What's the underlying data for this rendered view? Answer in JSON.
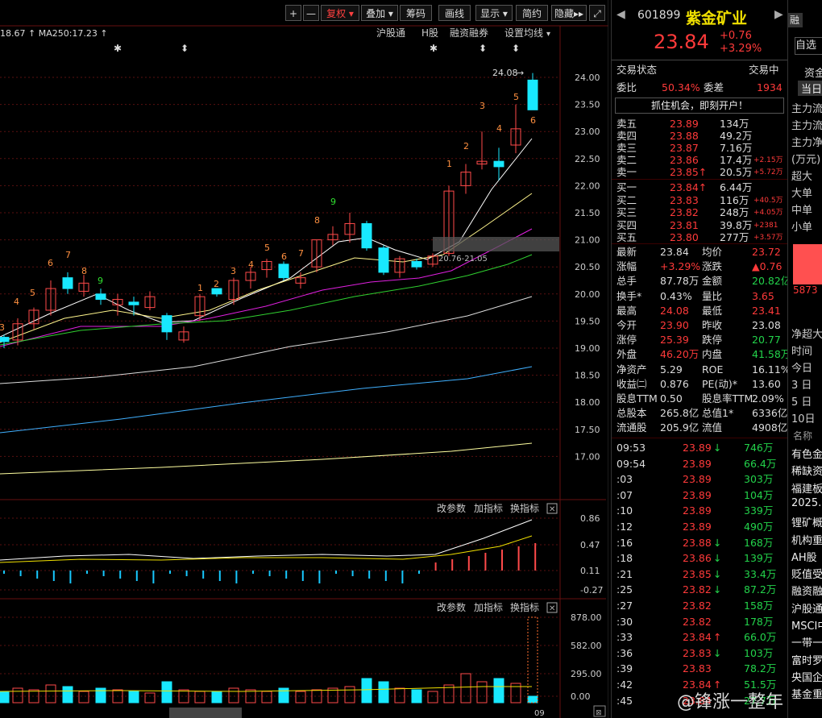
{
  "toolbar": {
    "buttons": [
      "+",
      "—",
      "复权",
      "叠加",
      "筹码",
      "画线",
      "显示",
      "简约",
      "隐藏"
    ],
    "expand_icon": "expand-icon"
  },
  "chart": {
    "ma_info": "18.67 ↑  MA250:17.23 ↑",
    "links": [
      "沪股通",
      "H股",
      "融资融券",
      "设置均线"
    ],
    "price_axis": [
      "24.00",
      "23.50",
      "23.00",
      "22.50",
      "22.00",
      "21.50",
      "21.00",
      "20.50",
      "20.00",
      "19.50",
      "19.00",
      "18.50",
      "18.00",
      "17.50",
      "17.00"
    ],
    "high_label": "24.08",
    "zone_label": "20.76-21.05",
    "td_labels": [
      "3",
      "4",
      "5",
      "6",
      "7",
      "8",
      "9",
      "1",
      "2",
      "3",
      "4",
      "5",
      "6",
      "7",
      "8",
      "9",
      "1",
      "2",
      "3",
      "4",
      "5",
      "6"
    ],
    "macd_axis": [
      "0.86",
      "0.47",
      "0.11",
      "-0.27"
    ],
    "vol_axis": [
      "878.00",
      "582.00",
      "295.00",
      "0.00"
    ],
    "sub_links": [
      "改参数",
      "加指标",
      "换指标"
    ],
    "date_label": "09"
  },
  "quote": {
    "code": "601899",
    "name": "紫金矿业",
    "price": "23.84",
    "change": "+0.76",
    "change_pct": "+3.29%",
    "rong": "融",
    "zi": "自选",
    "status_label": "交易状态",
    "status_value": "交易中",
    "weibi_label": "委比",
    "weibi_value": "50.34%",
    "weicha_label": "委差",
    "weicha_value": "1934",
    "banner": "抓住机会，即刻开户！",
    "asks": [
      {
        "label": "卖五",
        "price": "23.89",
        "vol": "134万",
        "chg": ""
      },
      {
        "label": "卖四",
        "price": "23.88",
        "vol": "49.2万",
        "chg": ""
      },
      {
        "label": "卖三",
        "price": "23.87",
        "vol": "7.16万",
        "chg": ""
      },
      {
        "label": "卖二",
        "price": "23.86",
        "vol": "17.4万",
        "chg": "+2.15万"
      },
      {
        "label": "卖一",
        "price": "23.85↑",
        "vol": "20.5万",
        "chg": "+5.72万"
      }
    ],
    "bids": [
      {
        "label": "买一",
        "price": "23.84↑",
        "vol": "6.44万",
        "chg": ""
      },
      {
        "label": "买二",
        "price": "23.83",
        "vol": "116万",
        "chg": "+40.5万"
      },
      {
        "label": "买三",
        "price": "23.82",
        "vol": "248万",
        "chg": "+4.05万"
      },
      {
        "label": "买四",
        "price": "23.81",
        "vol": "39.8万",
        "chg": "+2381"
      },
      {
        "label": "买五",
        "price": "23.80",
        "vol": "277万",
        "chg": "+3.57万"
      }
    ],
    "stats": [
      [
        "最新",
        "23.84",
        "均价",
        "23.72"
      ],
      [
        "涨幅",
        "+3.29%",
        "涨跌",
        "▲0.76"
      ],
      [
        "总手",
        "87.78万",
        "金额",
        "20.82亿"
      ],
      [
        "换手*",
        "0.43%",
        "量比",
        "3.65"
      ],
      [
        "最高",
        "24.08",
        "最低",
        "23.41"
      ],
      [
        "今开",
        "23.90",
        "昨收",
        "23.08"
      ],
      [
        "涨停",
        "25.39",
        "跌停",
        "20.77"
      ],
      [
        "外盘",
        "46.20万",
        "内盘",
        "41.58万"
      ],
      [
        "净资产",
        "5.29",
        "ROE",
        "16.11%"
      ],
      [
        "收益㈡",
        "0.876",
        "PE(动)*",
        "13.60"
      ],
      [
        "股息TTM",
        "0.50",
        "股息率TTM",
        "2.09%"
      ],
      [
        "总股本",
        "265.8亿",
        "总值1*",
        "6336亿"
      ],
      [
        "流通股",
        "205.9亿",
        "流值",
        "4908亿"
      ]
    ],
    "ticks": [
      {
        "t": "09:53",
        "p": "23.89",
        "arrow": "↓",
        "v": "746万"
      },
      {
        "t": "09:54",
        "p": "23.89",
        "arrow": "",
        "v": "66.4万"
      },
      {
        "t": ":03",
        "p": "23.89",
        "arrow": "",
        "v": "303万"
      },
      {
        "t": ":07",
        "p": "23.89",
        "arrow": "",
        "v": "104万"
      },
      {
        "t": ":10",
        "p": "23.89",
        "arrow": "",
        "v": "339万"
      },
      {
        "t": ":12",
        "p": "23.89",
        "arrow": "",
        "v": "490万"
      },
      {
        "t": ":16",
        "p": "23.88",
        "arrow": "↓",
        "v": "168万"
      },
      {
        "t": ":18",
        "p": "23.86",
        "arrow": "↓",
        "v": "139万"
      },
      {
        "t": ":21",
        "p": "23.85",
        "arrow": "↓",
        "v": "33.4万"
      },
      {
        "t": ":25",
        "p": "23.82",
        "arrow": "↓",
        "v": "87.2万"
      },
      {
        "t": ":27",
        "p": "23.82",
        "arrow": "",
        "v": "158万"
      },
      {
        "t": ":30",
        "p": "23.82",
        "arrow": "",
        "v": "178万"
      },
      {
        "t": ":33",
        "p": "23.84",
        "arrow": "↑",
        "v": "66.0万"
      },
      {
        "t": ":36",
        "p": "23.83",
        "arrow": "↓",
        "v": "103万"
      },
      {
        "t": ":39",
        "p": "23.83",
        "arrow": "",
        "v": "78.2万"
      },
      {
        "t": ":42",
        "p": "23.84",
        "arrow": "↑",
        "v": "51.5万"
      },
      {
        "t": ":45",
        "p": "23.84",
        "arrow": "",
        "v": "27.7万"
      }
    ]
  },
  "edge": {
    "tab_top": "资金",
    "tab_sub": "当日",
    "lines": [
      "主力流",
      "主力流",
      "主力净",
      "(万元)",
      "超大",
      "大单",
      "中单",
      "小单"
    ],
    "bar_value": "5873",
    "mid_lines": [
      "净超大",
      "时间",
      "今日",
      "3 日",
      "5 日",
      "10日"
    ],
    "name_label": "名称",
    "news": [
      "有色金",
      "稀缺资",
      "福建板",
      "2025.",
      "锂矿概",
      "机构重",
      "AH股",
      "贬值受",
      "融资融",
      "沪股通",
      "MSCI中",
      "一带一",
      "富时罗",
      "央国企",
      "基金重"
    ]
  },
  "watermark": "@锋涨一整年",
  "colors": {
    "up": "#ff3a3a",
    "down": "#23d34b",
    "flat": "#dddddd",
    "bg": "#000000",
    "cyan": "#00e5ff"
  }
}
